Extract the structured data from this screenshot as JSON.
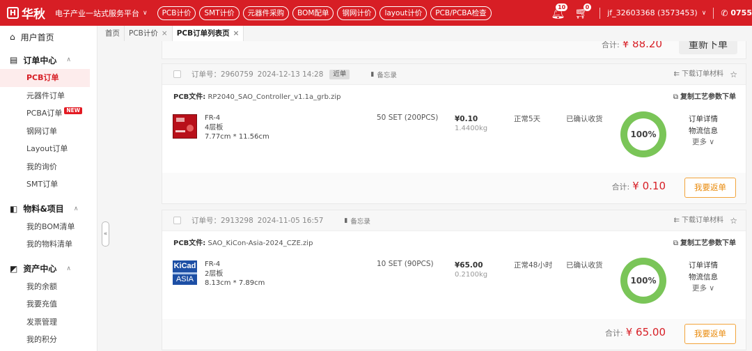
{
  "header": {
    "brand": "华秋",
    "logo_glyph": "H",
    "slogan": "电子产业一站式服务平台",
    "nav": [
      "PCB计价",
      "SMT计价",
      "元器件采购",
      "BOM配单",
      "钢网计价",
      "layout计价",
      "PCB/PCBA检查"
    ],
    "msg_count": "10",
    "cart_count": "0",
    "user": "jf_32603368 (3573453)",
    "phone": "0755",
    "brand_color": "#d71e25"
  },
  "sidebar": {
    "home": "用户首页",
    "groups": [
      {
        "label": "订单中心",
        "items": [
          "PCB订单",
          "元器件订单",
          "PCBA订单",
          "钢网订单",
          "Layout订单",
          "我的询价",
          "SMT订单"
        ]
      },
      {
        "label": "物料&项目",
        "items": [
          "我的BOM清单",
          "我的物料清单"
        ]
      },
      {
        "label": "资产中心",
        "items": [
          "我的余额",
          "我要充值",
          "发票管理",
          "我的积分"
        ]
      }
    ],
    "active_item": "PCB订单",
    "new_badge": "NEW",
    "collapse_glyph": "«"
  },
  "tabs": [
    {
      "label": "首页"
    },
    {
      "label": "PCB计价"
    },
    {
      "label": "PCB订单列表页"
    }
  ],
  "prev_order": {
    "total_label": "合计:",
    "total_amount": "¥ 88.20",
    "reorder": "重新下单"
  },
  "orders": [
    {
      "order_no": "订单号：2960759",
      "date": "2024-12-13 14:28",
      "tag": "近单",
      "memo": "备忘录",
      "download": "下载订单材料",
      "file_label": "PCB文件:",
      "file_name": "RP2040_SAO_Controller_v1.1a_grb.zip",
      "copy": "复制工艺参数下单",
      "material": "FR-4",
      "layers": "4层板",
      "size": "7.77cm * 11.56cm",
      "qty": "50 SET (200PCS)",
      "price": "¥0.10",
      "weight": "1.4400kg",
      "delivery": "正常5天",
      "status": "已确认收货",
      "progress": "100%",
      "link_detail": "订单详情",
      "link_logistics": "物流信息",
      "link_more": "更多",
      "total_label": "合计:",
      "total_amount": "¥ 0.10",
      "reorder": "我要返单"
    },
    {
      "order_no": "订单号：2913298",
      "date": "2024-11-05 16:57",
      "memo": "备忘录",
      "download": "下载订单材料",
      "file_label": "PCB文件:",
      "file_name": "SAO_KiCon-Asia-2024_CZE.zip",
      "copy": "复制工艺参数下单",
      "material": "FR-4",
      "layers": "2层板",
      "size": "8.13cm * 7.89cm",
      "qty": "10 SET (90PCS)",
      "price": "¥65.00",
      "weight": "0.2100kg",
      "delivery": "正常48小时",
      "status": "已确认收货",
      "progress": "100%",
      "link_detail": "订单详情",
      "link_logistics": "物流信息",
      "link_more": "更多",
      "total_label": "合计:",
      "total_amount": "¥ 65.00",
      "reorder": "我要返单",
      "thumb_text_top": "KiCad",
      "thumb_text_bottom": "ASIA"
    }
  ]
}
